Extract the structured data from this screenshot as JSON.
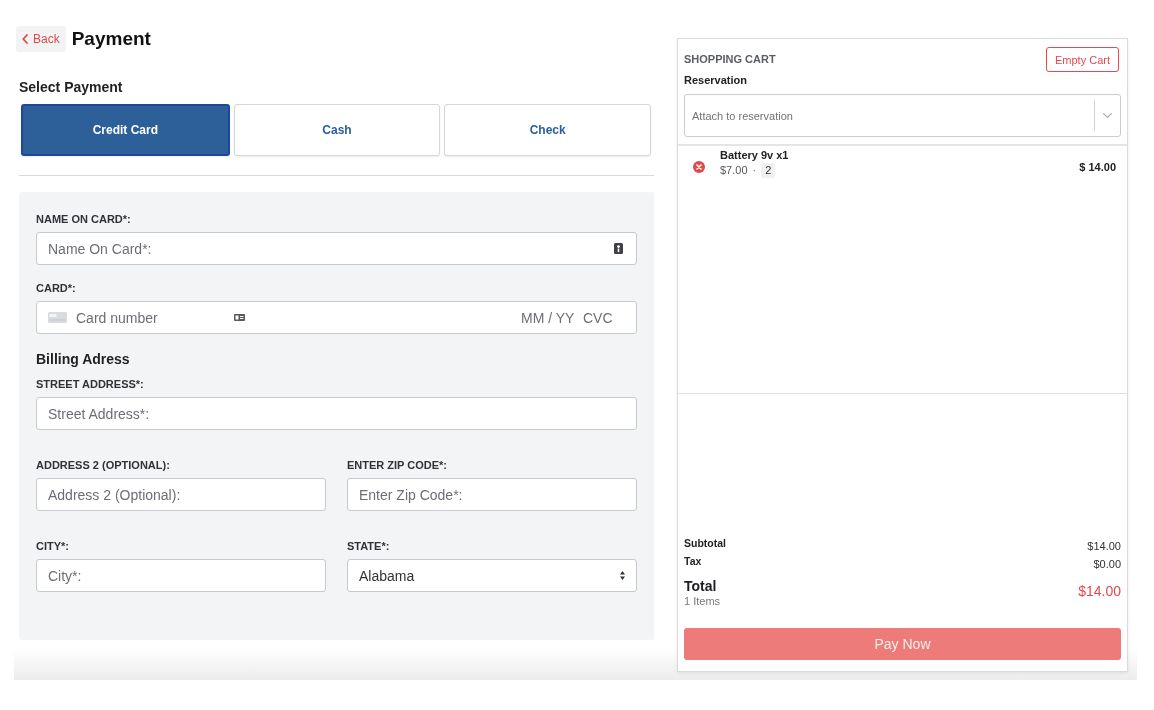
{
  "header": {
    "back_label": "Back",
    "title": "Payment"
  },
  "payment": {
    "heading": "Select Payment",
    "methods": [
      {
        "label": "Credit Card",
        "selected": true
      },
      {
        "label": "Cash",
        "selected": false
      },
      {
        "label": "Check",
        "selected": false
      }
    ]
  },
  "card_form": {
    "name_on_card": {
      "label": "NAME ON CARD*:",
      "placeholder": "Name On Card*:"
    },
    "card": {
      "label": "CARD*:",
      "number_placeholder": "Card number",
      "expiry_placeholder": "MM / YY",
      "cvc_placeholder": "CVC"
    },
    "billing_heading": "Billing Adress",
    "street": {
      "label": "STREET ADDRESS*:",
      "placeholder": "Street Address*:"
    },
    "address2": {
      "label": "ADDRESS 2 (OPTIONAL):",
      "placeholder": "Address 2 (Optional):"
    },
    "zip": {
      "label": "ENTER ZIP CODE*:",
      "placeholder": "Enter Zip Code*:"
    },
    "city": {
      "label": "CITY*:",
      "placeholder": "City*:"
    },
    "state": {
      "label": "STATE*:",
      "value": "Alabama"
    }
  },
  "cart": {
    "title": "SHOPPING CART",
    "empty_button": "Empty Cart",
    "reservation": {
      "label": "Reservation",
      "placeholder": "Attach to reservation"
    },
    "items": [
      {
        "name": "Battery 9v x1",
        "unit_price": "$7.00",
        "separator": "·",
        "quantity": "2",
        "total": "$ 14.00"
      }
    ],
    "summary": {
      "subtotal_label": "Subtotal",
      "subtotal": "$14.00",
      "tax_label": "Tax",
      "tax": "$0.00",
      "total_label": "Total",
      "item_count": "1 Items",
      "total": "$14.00"
    },
    "pay_button": "Pay Now"
  }
}
